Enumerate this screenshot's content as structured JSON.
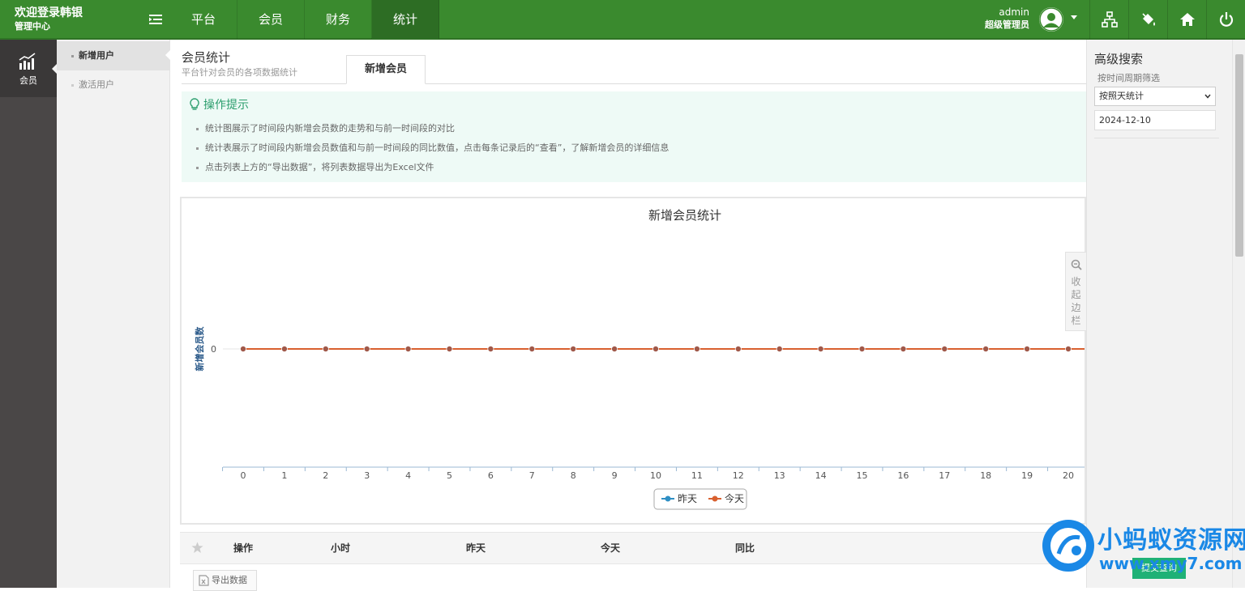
{
  "header": {
    "brand_line1": "欢迎登录韩银",
    "brand_line2": "管理中心",
    "nav": [
      "平台",
      "会员",
      "财务",
      "统计"
    ],
    "active_nav": "统计",
    "user_name": "admin",
    "user_role": "超级管理员",
    "colors": {
      "bar": "#3a8a2e",
      "active": "#2d6d24"
    }
  },
  "left_sidebar": {
    "item_label": "会员",
    "item_icon": "bar-chart-icon"
  },
  "sub_nav": {
    "items": [
      "新增用户",
      "激活用户"
    ],
    "active": "新增用户"
  },
  "page": {
    "title": "会员统计",
    "subtitle": "平台针对会员的各项数据统计",
    "tab_label": "新增会员"
  },
  "tips": {
    "heading": "操作提示",
    "lines": [
      "统计图展示了时间段内新增会员数的走势和与前一时间段的对比",
      "统计表展示了时间段内新增会员数值和与前一时间段的同比数值，点击每条记录后的“查看”，了解新增会员的详细信息",
      "点击列表上方的“导出数据”，将列表数据导出为Excel文件"
    ]
  },
  "chart_data": {
    "type": "line",
    "title": "新增会员统计",
    "ylabel": "新增会员数",
    "x": [
      "0",
      "1",
      "2",
      "3",
      "4",
      "5",
      "6",
      "7",
      "8",
      "9",
      "10",
      "11",
      "12",
      "13",
      "14",
      "15",
      "16",
      "17",
      "18",
      "19",
      "20"
    ],
    "y_ticks": [
      "0"
    ],
    "series": [
      {
        "name": "昨天",
        "values": [
          0,
          0,
          0,
          0,
          0,
          0,
          0,
          0,
          0,
          0,
          0,
          0,
          0,
          0,
          0,
          0,
          0,
          0,
          0,
          0,
          0
        ],
        "color": "#2f8fc4"
      },
      {
        "name": "今天",
        "values": [
          0,
          0,
          0,
          0,
          0,
          0,
          0,
          0,
          0,
          0,
          0,
          0,
          0,
          0,
          0,
          0,
          0,
          0,
          0,
          0,
          0
        ],
        "color": "#d9602f"
      }
    ],
    "legend": "bottom-center"
  },
  "collapse_sidebar": {
    "label": "收起边栏"
  },
  "table": {
    "columns": [
      "操作",
      "小时",
      "昨天",
      "今天",
      "同比"
    ]
  },
  "export_label": "导出数据",
  "right_panel": {
    "title": "高级搜索",
    "filter_label": "按时间周期筛选",
    "select_value": "按照天统计",
    "date_value": "2024-12-10",
    "submit_label": "提交查询"
  },
  "watermark": {
    "text1": "小蚂蚁资源网",
    "text2": "www.xmy7.com"
  }
}
